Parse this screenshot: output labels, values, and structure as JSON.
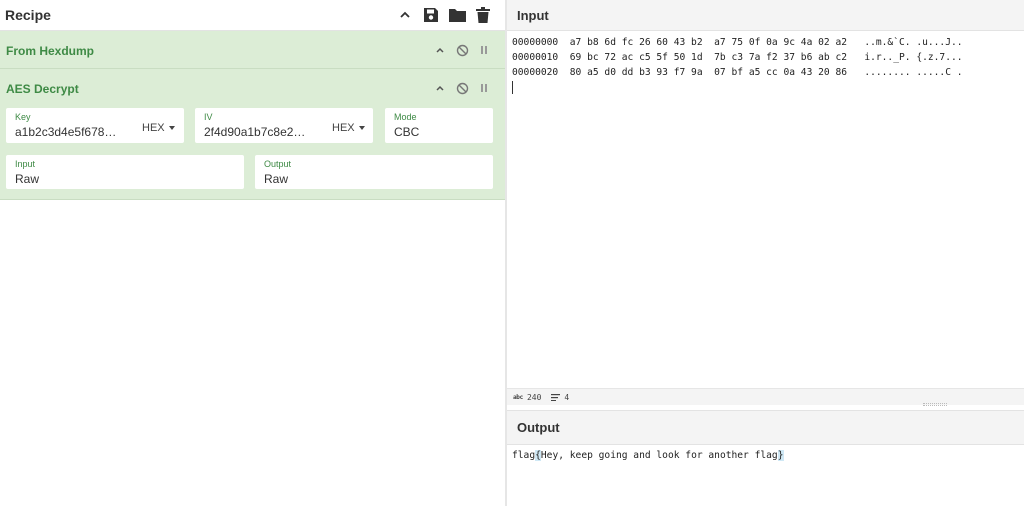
{
  "recipe": {
    "title": "Recipe",
    "icons": [
      "chevron-up-icon",
      "save-icon",
      "folder-icon",
      "trash-icon"
    ]
  },
  "operations": [
    {
      "title": "From Hexdump",
      "icons": [
        "chevron-up-icon",
        "disable-icon",
        "pause-icon"
      ]
    },
    {
      "title": "AES Decrypt",
      "icons": [
        "chevron-up-icon",
        "disable-icon",
        "pause-icon"
      ],
      "fields": {
        "key": {
          "label": "Key",
          "value": "a1b2c3d4e5f678…",
          "format": "HEX"
        },
        "iv": {
          "label": "IV",
          "value": "2f4d90a1b7c8e2…",
          "format": "HEX"
        },
        "mode": {
          "label": "Mode",
          "value": "CBC"
        },
        "input": {
          "label": "Input",
          "value": "Raw"
        },
        "output": {
          "label": "Output",
          "value": "Raw"
        }
      }
    }
  ],
  "input": {
    "title": "Input",
    "lines": [
      "00000000  a7 b8 6d fc 26 60 43 b2  a7 75 0f 0a 9c 4a 02 a2   ..m.&`C. .u...J..",
      "00000010  69 bc 72 ac c5 5f 50 1d  7b c3 7a f2 37 b6 ab c2   i.r.._P. {.z.7...",
      "00000020  80 a5 d0 dd b3 93 f7 9a  07 bf a5 cc 0a 43 20 86   ........ .....C ."
    ]
  },
  "status": {
    "length_label": "abc",
    "length": "240",
    "lines": "4"
  },
  "output": {
    "title": "Output",
    "text_prefix": "flag",
    "brace_open": "{",
    "text_body": "Hey, keep going and look for another flag",
    "brace_close": "}"
  },
  "colors": {
    "op_background": "#dcedd6",
    "op_title": "#3e8a45",
    "brace_highlight": "#cfe8f5"
  }
}
